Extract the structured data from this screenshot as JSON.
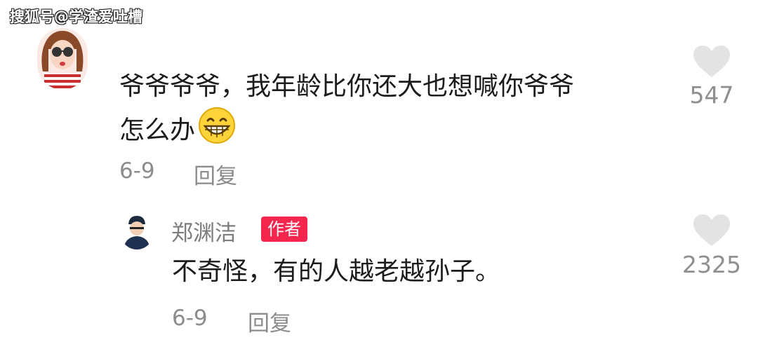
{
  "watermark": "搜狐号@学渣爱吐槽",
  "comment": {
    "text_line1": "爷爷爷爷，我年龄比你还大也想喊你爷爷",
    "text_line2": "怎么办",
    "emoji": "grinning-face-emoji",
    "date": "6-9",
    "reply_label": "回复",
    "likes": "547"
  },
  "reply": {
    "username": "郑渊洁",
    "badge": "作者",
    "text": "不奇怪，有的人越老越孙子。",
    "date": "6-9",
    "reply_label": "回复",
    "likes": "2325"
  },
  "colors": {
    "badge": "#f5264e",
    "meta_text": "#8c8c8c",
    "heart": "#e3e3e3"
  }
}
